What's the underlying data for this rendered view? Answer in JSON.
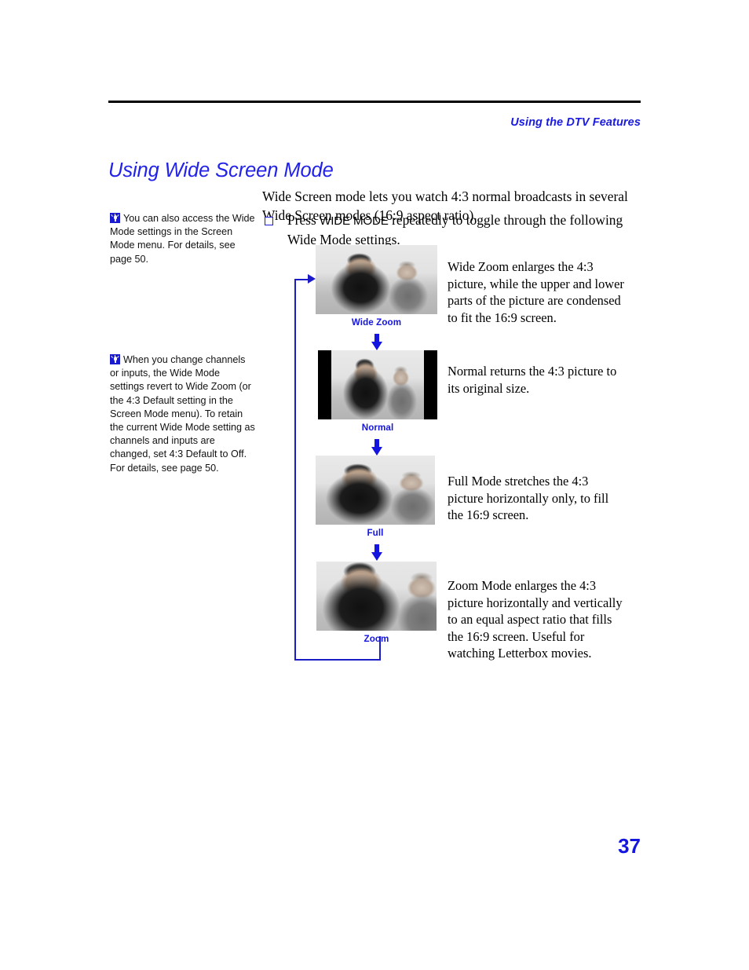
{
  "header": {
    "running_head": "Using the DTV Features"
  },
  "page": {
    "title": "Using Wide Screen Mode",
    "number": "37"
  },
  "body": {
    "intro": "Wide Screen mode lets you watch 4:3 normal broadcasts in several Wide Screen modes (16:9 aspect ratio).",
    "step": {
      "bullet_icon": "square-bullet-icon",
      "text_before": "Press ",
      "keycap": "WIDE MODE",
      "text_after": " repeatedly to toggle through the following Wide Mode settings."
    }
  },
  "margin_notes": [
    {
      "icon": "tip-lightbulb-icon",
      "text": "You can also access the Wide Mode settings in the Screen Mode menu. For details, see page 50."
    },
    {
      "icon": "tip-lightbulb-icon",
      "text": "When you change channels or inputs, the Wide Mode settings revert to Wide Zoom (or the 4:3 Default setting in the Screen Mode menu). To retain the current Wide Mode setting as channels and inputs are changed, set 4:3 Default to Off. For details, see page 50."
    }
  ],
  "diagram": {
    "loop_arrow_icon": "loop-back-arrow-icon",
    "modes": [
      {
        "label": "Wide Zoom",
        "image_alt": "grayscale photo of two people on a beach, stretched wide",
        "has_side_bars": false,
        "description": "Wide Zoom enlarges the 4:3 picture, while the upper and lower parts of the picture are condensed to fit the 16:9 screen."
      },
      {
        "label": "Normal",
        "image_alt": "grayscale photo of two people on a beach with black side bars",
        "has_side_bars": true,
        "description": "Normal returns the 4:3 picture to its original size."
      },
      {
        "label": "Full",
        "image_alt": "grayscale photo of two people on a beach, stretched horizontally",
        "has_side_bars": false,
        "description": "Full Mode stretches the 4:3 picture horizontally only, to fill the 16:9 screen."
      },
      {
        "label": "Zoom",
        "image_alt": "grayscale photo of two people on a beach, enlarged equally",
        "has_side_bars": false,
        "description": "Zoom Mode enlarges the 4:3 picture horizontally and vertically to an equal aspect ratio that fills the 16:9 screen. Useful for watching Letterbox movies."
      }
    ],
    "arrow_icons": [
      "down-arrow-icon",
      "down-arrow-icon",
      "down-arrow-icon"
    ]
  },
  "colors": {
    "accent_blue": "#1515e0",
    "heading_blue": "#2222e8",
    "rule_black": "#000000"
  }
}
